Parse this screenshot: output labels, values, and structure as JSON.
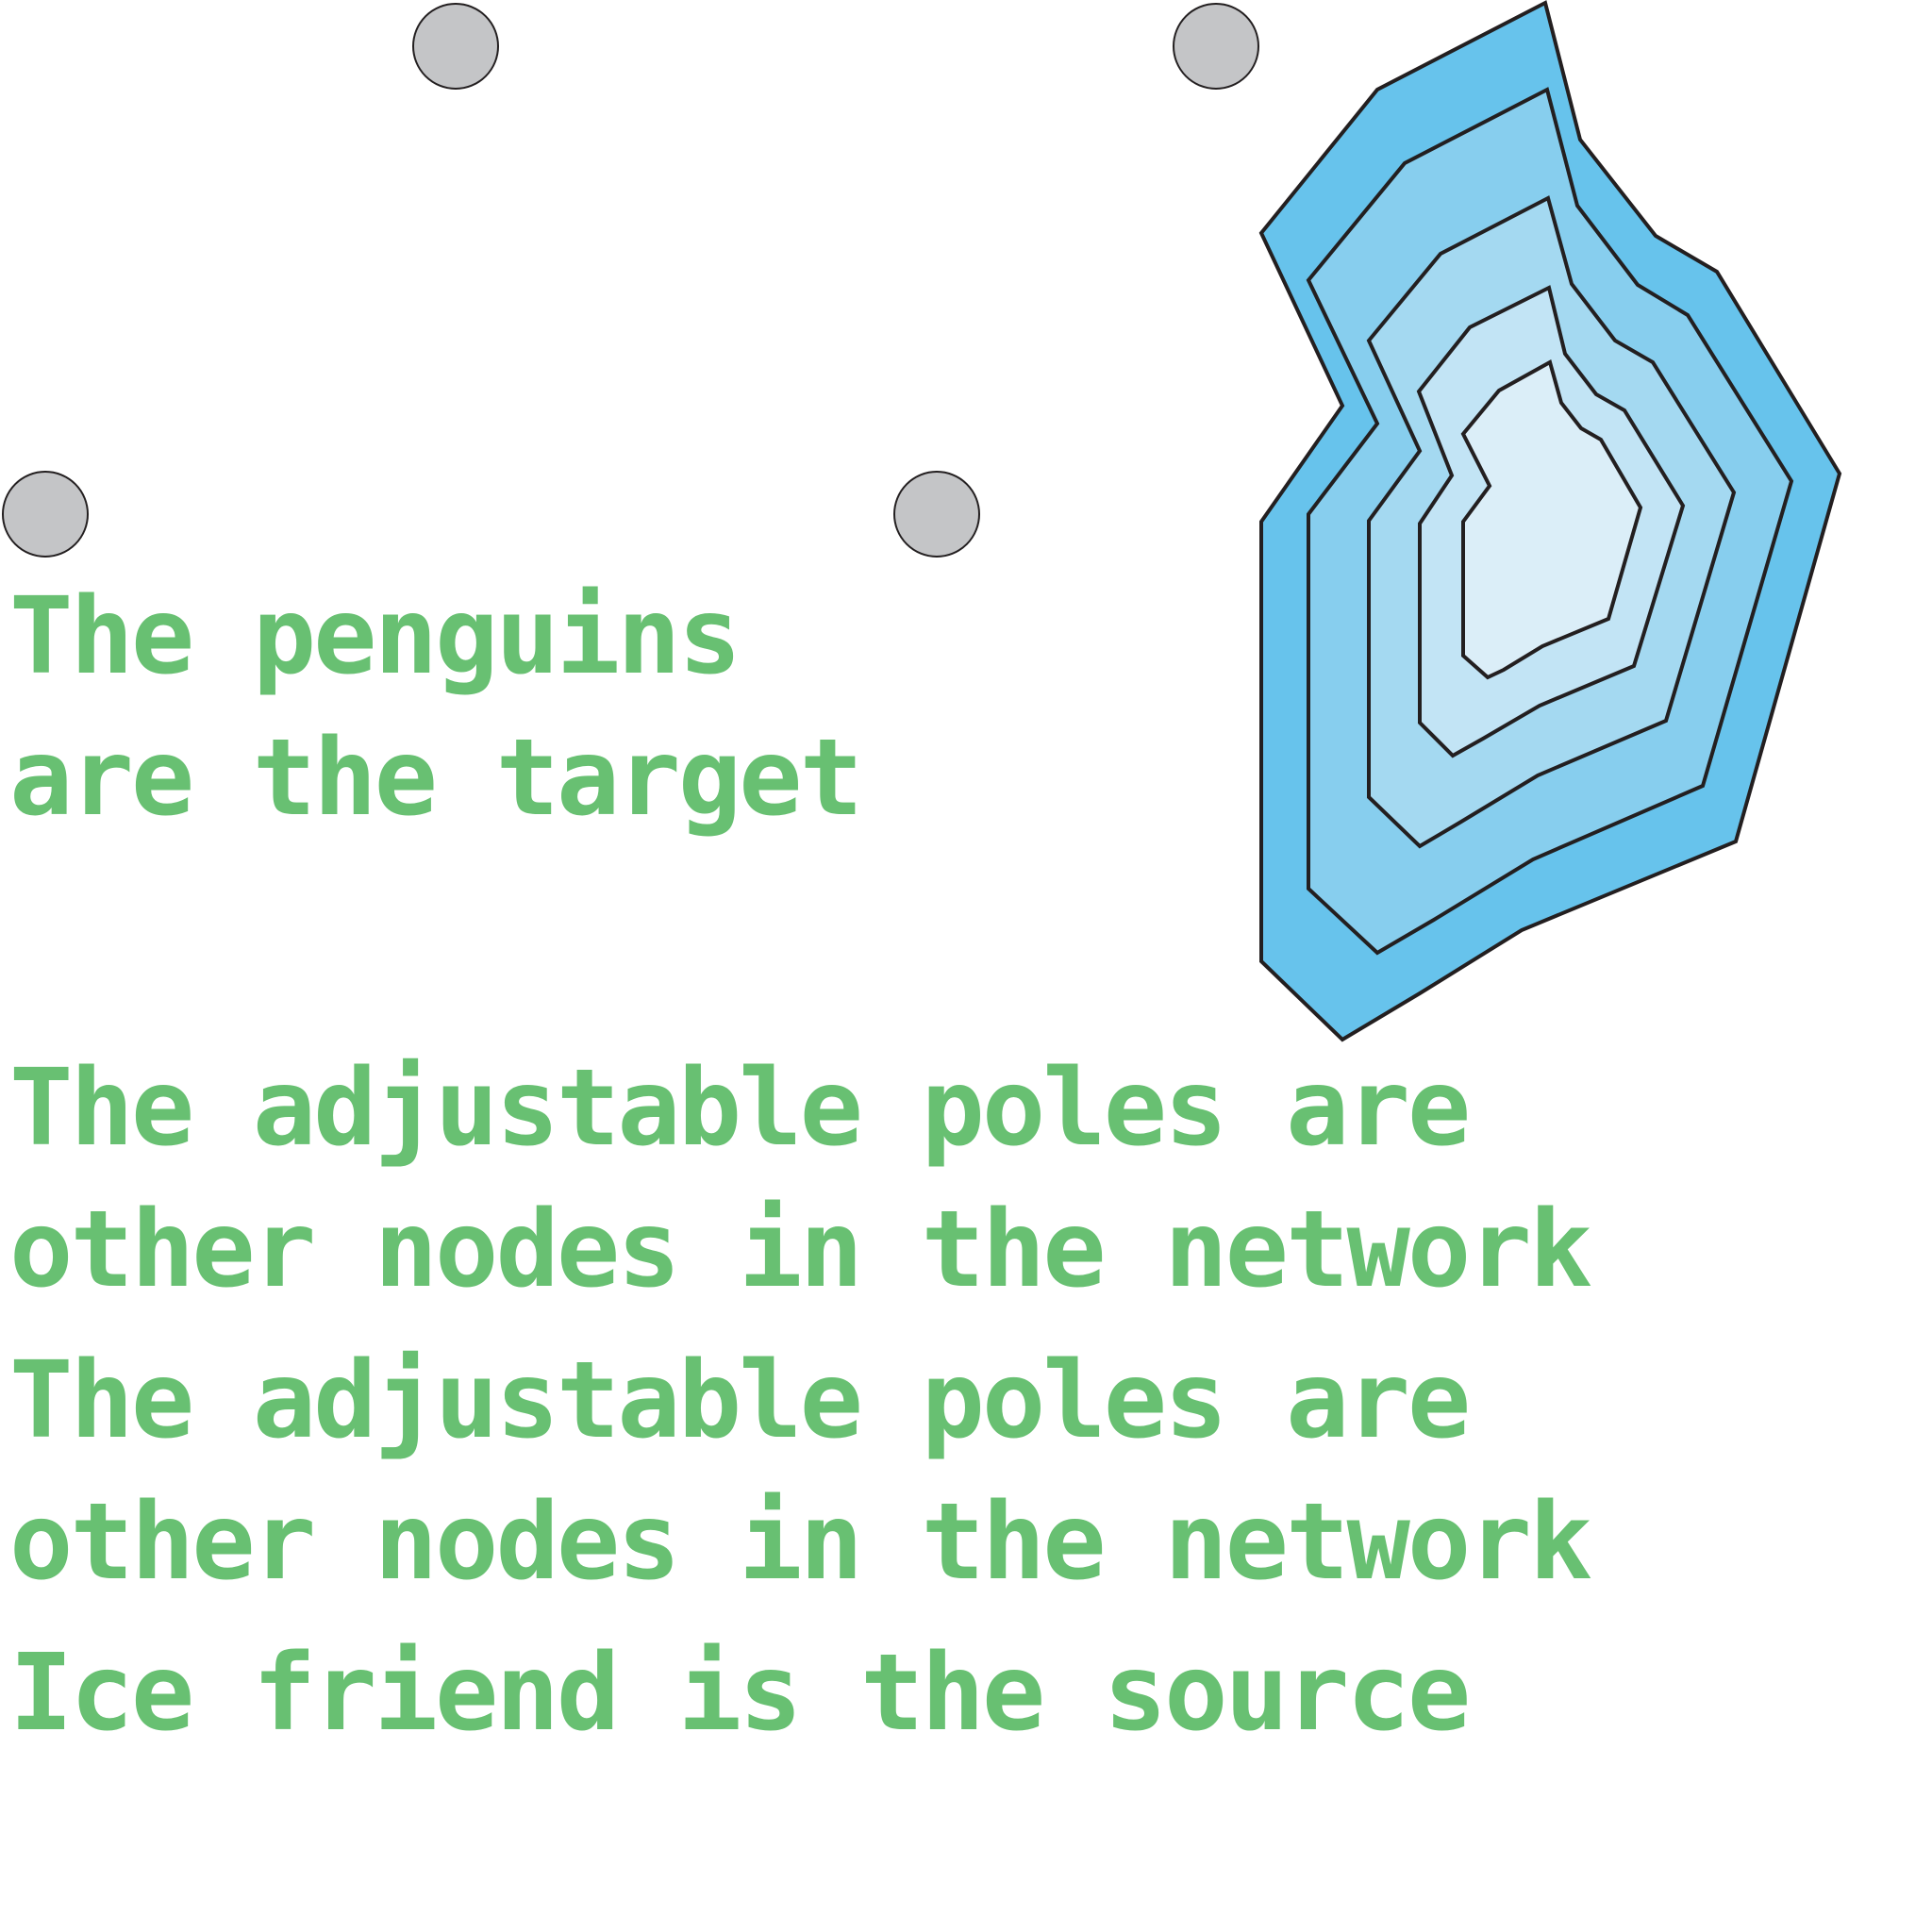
{
  "colors": {
    "text": "#68c072",
    "pole_fill": "#c4c5c7",
    "outline": "#231f20",
    "ice_rings": [
      "#67c3ec",
      "#87ceee",
      "#a4d9f1",
      "#c2e4f5",
      "#dbeef8"
    ]
  },
  "poles": [
    {
      "name": "pole-top-left"
    },
    {
      "name": "pole-top-right"
    },
    {
      "name": "pole-mid-left"
    },
    {
      "name": "pole-mid-right"
    }
  ],
  "ice_friend": {
    "icon": "ice-contour-icon",
    "rings": 5
  },
  "labels": {
    "target": [
      "The penguins",
      "are the target"
    ],
    "poles_1": [
      "The adjustable poles are",
      "other nodes in the network"
    ],
    "poles_2": [
      "The adjustable poles are",
      "other nodes in the network"
    ],
    "source": [
      "Ice friend is the source"
    ]
  }
}
